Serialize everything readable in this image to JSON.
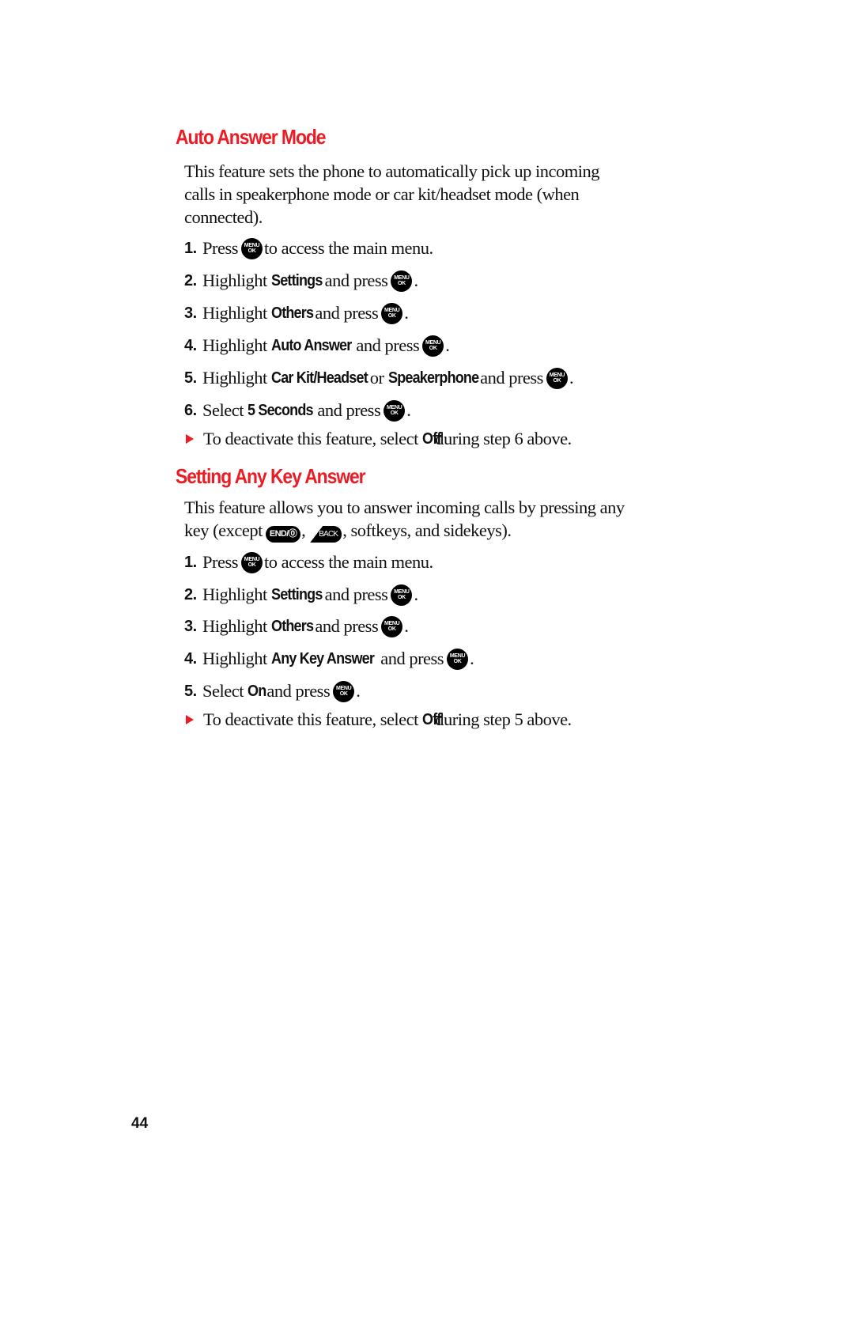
{
  "colors": {
    "heading": "#ec1c24",
    "bullet_arrow": "#ec1c24",
    "text": "#111111",
    "key_icon": "#000000"
  },
  "icons": {
    "menu_ok": {
      "top": "MENU",
      "bottom": "OK"
    },
    "end_key": "END/⓪",
    "back_key": "BACK"
  },
  "section1": {
    "title": "Auto Answer Mode",
    "intro_lines": [
      "This feature sets the phone to automatically pick up incoming",
      "calls in speakerphone mode or car kit/headset mode (when",
      "connected)."
    ],
    "steps": [
      {
        "num": "1.",
        "pre": "Press",
        "post": "to access the main menu."
      },
      {
        "num": "2.",
        "pre": "Highlight",
        "bold": "Settings",
        "mid": "and press",
        "end": "."
      },
      {
        "num": "3.",
        "pre": "Highlight",
        "bold": "Others",
        "mid": "and press",
        "end": "."
      },
      {
        "num": "4.",
        "pre": "Highlight",
        "bold": "Auto Answer",
        "mid": "and press",
        "end": "."
      },
      {
        "num": "5.",
        "pre": "Highlight",
        "bold": "Car Kit/Headset",
        "or": "or",
        "bold2": "Speakerphone",
        "mid": "and press",
        "end": "."
      },
      {
        "num": "6.",
        "pre": "Select",
        "bold": "5 Seconds",
        "mid": "and press",
        "end": "."
      }
    ],
    "note": {
      "pre": "To deactivate this feature, select",
      "bold": "Off",
      "post": "during step 6 above."
    }
  },
  "section2": {
    "title": "Setting Any Key Answer",
    "intro_line1": "This feature allows you to answer incoming calls by pressing any",
    "intro_line2_pre": "key (except",
    "intro_line2_comma": ",",
    "intro_line2_post": ", softkeys, and sidekeys).",
    "steps": [
      {
        "num": "1.",
        "pre": "Press",
        "post": "to access the main menu."
      },
      {
        "num": "2.",
        "pre": "Highlight",
        "bold": "Settings",
        "mid": "and press",
        "end": "."
      },
      {
        "num": "3.",
        "pre": "Highlight",
        "bold": "Others",
        "mid": "and press",
        "end": "."
      },
      {
        "num": "4.",
        "pre": "Highlight",
        "bold": "Any Key Answer",
        "mid": "and press",
        "end": "."
      },
      {
        "num": "5.",
        "pre": "Select",
        "bold": "On",
        "mid": "and press",
        "end": "."
      }
    ],
    "note": {
      "pre": "To deactivate this feature, select",
      "bold": "Off",
      "post": "during step 5 above."
    }
  },
  "page_number": "44"
}
